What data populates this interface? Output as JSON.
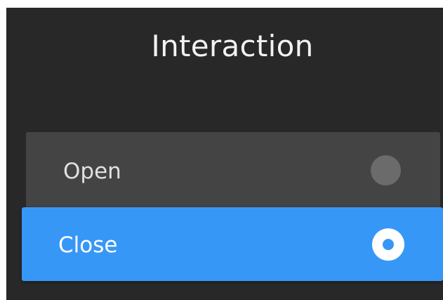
{
  "dialog": {
    "title": "Interaction",
    "options": [
      {
        "label": "Open",
        "selected": false
      },
      {
        "label": "Close",
        "selected": true
      }
    ]
  },
  "colors": {
    "background": "#282828",
    "option_bg": "#444444",
    "selected_bg": "#3797f6",
    "unselected_radio": "#6b6b6b",
    "text": "#f2f2f2"
  },
  "icons": {
    "unselected": "radio-unchecked-icon",
    "selected": "radio-checked-icon"
  }
}
